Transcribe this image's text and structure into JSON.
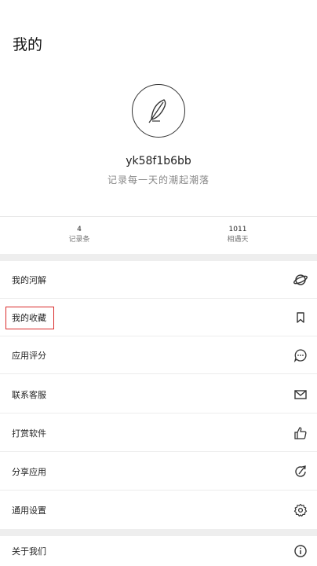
{
  "header": {
    "title": "我的"
  },
  "profile": {
    "avatar_icon": "feather-icon",
    "username": "yk58f1b6bb",
    "tagline": "记录每一天的潮起潮落"
  },
  "stats": [
    {
      "value": "4",
      "label": "记录条"
    },
    {
      "value": "1011",
      "label": "相遇天"
    }
  ],
  "menu": [
    {
      "label": "我的河解",
      "icon": "planet-icon"
    },
    {
      "label": "我的收藏",
      "icon": "bookmark-icon"
    },
    {
      "label": "应用评分",
      "icon": "chat-bubble-icon"
    },
    {
      "label": "联系客服",
      "icon": "mail-icon"
    },
    {
      "label": "打赏软件",
      "icon": "thumbs-up-icon"
    },
    {
      "label": "分享应用",
      "icon": "share-icon"
    },
    {
      "label": "通用设置",
      "icon": "gear-icon"
    },
    {
      "label": "关于我们",
      "icon": "info-icon"
    }
  ],
  "colors": {
    "highlight": "#d92b2b",
    "divider": "#eeeeee"
  }
}
